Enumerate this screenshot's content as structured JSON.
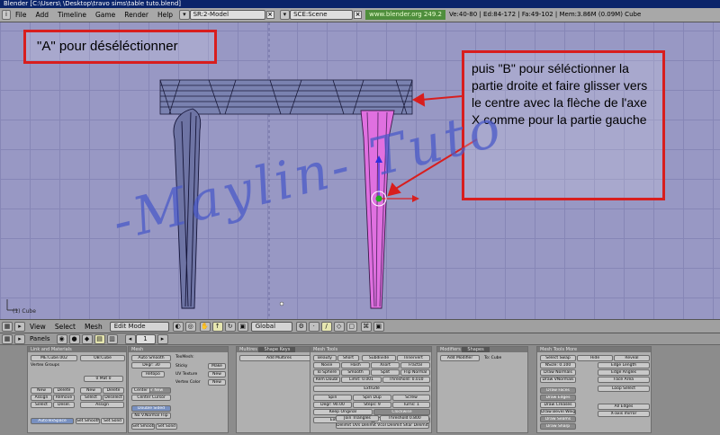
{
  "window": {
    "title": "Blender [C:\\Users\\          \\Desktop\\travo sims\\table tuto.blend]"
  },
  "info_header": {
    "icon": "i",
    "menus": [
      "File",
      "Add",
      "Timeline",
      "Game",
      "Render",
      "Help"
    ],
    "screen": "SR:2-Model",
    "scene": "SCE:Scene",
    "url": "www.blender.org 249.2",
    "stats": "Ve:40-80 | Ed:84-172 | Fa:49-102 | Mem:3.86M (0.09M) Cube"
  },
  "viewport": {
    "callout_a": "\"A\" pour déséléctionner",
    "callout_b": "puis \"B\" pour séléctionner la partie droite et faire glisser vers le centre avec la flèche de l'axe X comme pour la partie gauche",
    "watermark": "-Maylin- Tuto",
    "object_label": "(1) Cube",
    "colors": {
      "grid_bg": "#9898c4",
      "callout_border": "#d81e1e",
      "selected_leg": "#e070e0",
      "watermark": "#4a5ac8"
    }
  },
  "view_header": {
    "menus": [
      "View",
      "Select",
      "Mesh"
    ],
    "mode": "Edit Mode",
    "orientation": "Global"
  },
  "buttons": {
    "panels_label": "Panels",
    "frame": "1",
    "link_materials": {
      "title": "Link and Materials",
      "me": "ME:Cube.002",
      "ob": "OB:Cube",
      "vertex_groups": "Vertex Groups",
      "mat": "0 Mat 0",
      "row1": [
        "New",
        "Delete",
        "New",
        "Delete"
      ],
      "row2": [
        "Assign",
        "Remove",
        "Select",
        "Deselect"
      ],
      "row3": [
        "Select",
        "Desel.",
        "Assign"
      ],
      "row4": [
        "AutoTexSpace",
        "Set Smooth",
        "Set Solid"
      ]
    },
    "mesh": {
      "title": "Mesh",
      "auto_smooth": "Auto Smooth",
      "degr": "Degr: 30",
      "sticky": "Sticky",
      "make": "Make",
      "uv_texture": "UV Texture",
      "vertex_color": "Vertex Color",
      "new1": "New",
      "new2": "New",
      "texmesh": "TexMesh:",
      "center_new": "Center New",
      "center": "Center",
      "center_cursor": "Center Cursor",
      "double_sided": "Double Sided",
      "no_v_normal_flip": "No V.Normal Flip",
      "set_smooth": "Set Smooth",
      "set_solid": "Set Solid"
    },
    "multires": {
      "title": "Multires",
      "tab2": "Shape Keys",
      "add": "Add Multires"
    },
    "mesh_tools": {
      "title": "Mesh Tools",
      "r1": [
        "Beauty",
        "Short",
        "Subdivide",
        "Innervert"
      ],
      "r2": [
        "Noise",
        "Hash",
        "Xsort",
        "Fractal"
      ],
      "r3": [
        "To Sphere",
        "Smooth",
        "Split",
        "Flip Normal"
      ],
      "r4": [
        "Rem Doubl",
        "Limit: 0.001",
        "Threshold: 0.010"
      ],
      "extrude": "Extrude",
      "r5": [
        "Spin",
        "Spin Dup",
        "Screw"
      ],
      "r6": [
        "Degr: 90.00",
        "Steps: 9",
        "Turns: 1"
      ],
      "keep_original": "Keep Original",
      "clockwise": "Clockwise",
      "extrude_dup": "Extrude Dup",
      "offset": "Offset: 1.00",
      "join_triangles": "Join Triangles",
      "threshold": "Threshold 0.800",
      "delimit": "Delimit UVs Delimit Vcol Delimit Shar Delimit Mat"
    },
    "modifiers": {
      "title": "Modifiers",
      "tab2": "Shapes",
      "add": "Add Modifier",
      "to": "To: Cube"
    },
    "mesh_tools_more": {
      "title": "Mesh Tools More",
      "r1": [
        "Select Swap",
        "Hide",
        "Reveal"
      ],
      "nsize": "NSize: 0.100",
      "draw_normals": "Draw Normals",
      "draw_vnormals": "Draw VNormals",
      "edge_length": "Edge Length",
      "edge_angles": "Edge Angles",
      "face_area": "Face Area",
      "draw_faces": "Draw Faces",
      "draw_edges": "Draw Edges",
      "draw_creases": "Draw Creases",
      "draw_bevel": "Draw Bevel Weights",
      "draw_seams": "Draw Seams",
      "draw_sharp": "Draw Sharp",
      "loop_select": "Loop Select",
      "all_edges": "All Edges",
      "xaxis_mirror": "X-axis mirror"
    }
  }
}
